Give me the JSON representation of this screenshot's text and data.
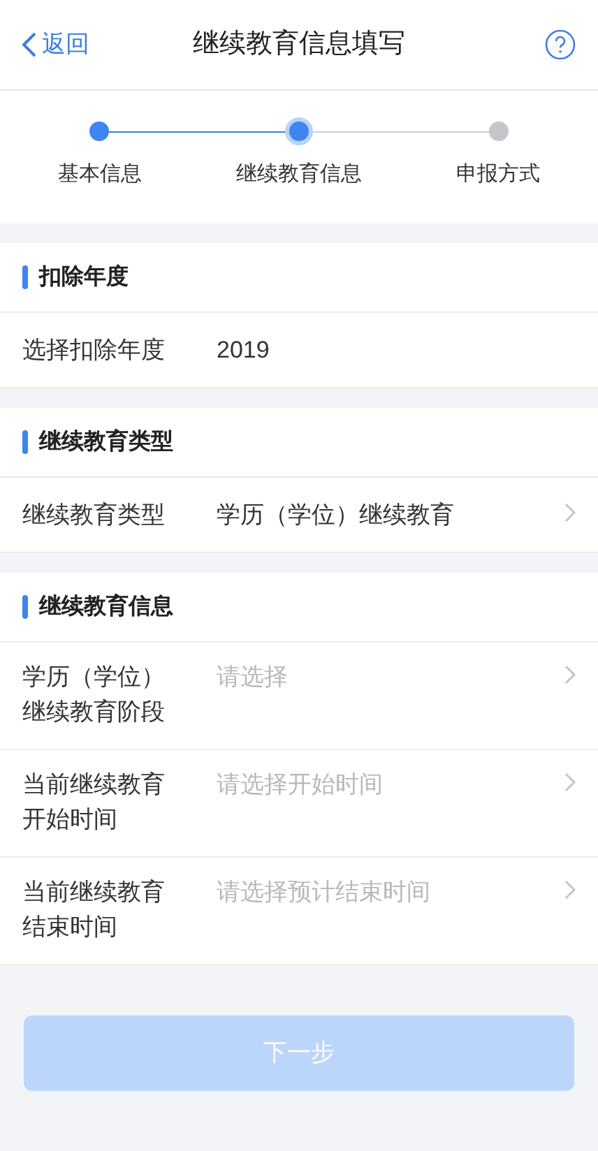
{
  "nav": {
    "back": "返回",
    "title": "继续教育信息填写"
  },
  "steps": [
    {
      "label": "基本信息",
      "done": true,
      "selected": false
    },
    {
      "label": "继续教育信息",
      "done": true,
      "selected": true
    },
    {
      "label": "申报方式",
      "done": false,
      "selected": false
    }
  ],
  "sections": [
    {
      "title": "扣除年度",
      "rows": [
        {
          "label": "选择扣除年度",
          "value": "2019",
          "chevron": false
        }
      ]
    },
    {
      "title": "继续教育类型",
      "rows": [
        {
          "label": "继续教育类型",
          "value": "学历（学位）继续教育",
          "chevron": true
        }
      ]
    },
    {
      "title": "继续教育信息",
      "rows": [
        {
          "label": "学历（学位）继续教育阶段",
          "placeholder": "请选择",
          "chevron": true
        },
        {
          "label": "当前继续教育开始时间",
          "placeholder": "请选择开始时间",
          "chevron": true
        },
        {
          "label": "当前继续教育结束时间",
          "placeholder": "请选择预计结束时间",
          "chevron": true
        }
      ]
    }
  ],
  "next_button": {
    "label": "下一步",
    "disabled": true
  }
}
